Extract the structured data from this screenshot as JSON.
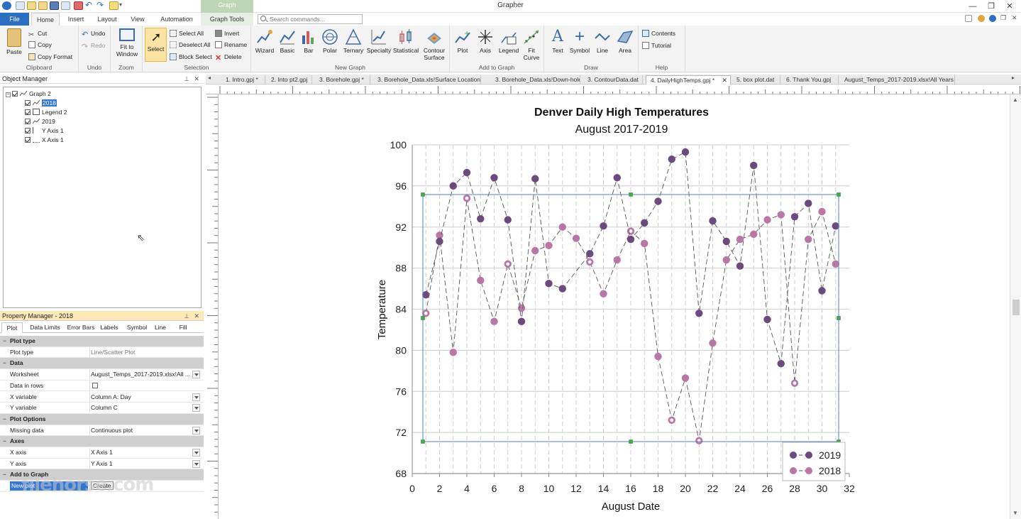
{
  "app": {
    "title": "Grapher",
    "context_group": "Graph"
  },
  "ribbon_tabs": [
    "File",
    "Home",
    "Insert",
    "Layout",
    "View",
    "Automation",
    "Graph Tools"
  ],
  "search": {
    "placeholder": "Search commands..."
  },
  "ribbon": {
    "clipboard": {
      "label": "Clipboard",
      "paste": "Paste",
      "cut": "Cut",
      "copy": "Copy",
      "copy_format": "Copy Format"
    },
    "undo": {
      "label": "Undo",
      "undo": "Undo",
      "redo": "Redo"
    },
    "zoom": {
      "label": "Zoom",
      "fit": "Fit to Window"
    },
    "selection": {
      "label": "Selection",
      "select": "Select",
      "select_all": "Select All",
      "deselect_all": "Deselect All",
      "block_select": "Block Select",
      "invert": "Invert",
      "rename": "Rename",
      "delete": "Delete"
    },
    "new_graph": {
      "label": "New Graph",
      "items": [
        "Wizard",
        "Basic",
        "Bar",
        "Polar",
        "Ternary",
        "Specialty",
        "Statistical",
        "Contour Surface"
      ]
    },
    "add_to_graph": {
      "label": "Add to Graph",
      "items": [
        "Plot",
        "Axis",
        "Legend",
        "Fit Curve"
      ]
    },
    "draw": {
      "label": "Draw",
      "items": [
        "Text",
        "Symbol",
        "Line",
        "Area"
      ]
    },
    "help": {
      "label": "Help",
      "contents": "Contents",
      "tutorial": "Tutorial"
    }
  },
  "object_manager": {
    "title": "Object Manager",
    "items": [
      {
        "label": "Graph 2",
        "level": 0
      },
      {
        "label": "2018",
        "level": 1,
        "selected": true
      },
      {
        "label": "Legend 2",
        "level": 1
      },
      {
        "label": "2019",
        "level": 1
      },
      {
        "label": "Y Axis 1",
        "level": 1
      },
      {
        "label": "X Axis 1",
        "level": 1
      }
    ]
  },
  "property_manager": {
    "title": "Property Manager - 2018",
    "tabs": [
      "Plot",
      "Data Limits",
      "Error Bars",
      "Labels",
      "Symbol",
      "Line",
      "Fill"
    ],
    "rows": [
      {
        "section": "Plot type"
      },
      {
        "k": "Plot type",
        "v": "Line/Scatter Plot"
      },
      {
        "section": "Data"
      },
      {
        "k": "Worksheet",
        "v": "August_Temps_2017-2019.xlsx!All ..."
      },
      {
        "k": "Data in rows",
        "v": ""
      },
      {
        "k": "X variable",
        "v": "Column A: Day"
      },
      {
        "k": "Y variable",
        "v": "Column C"
      },
      {
        "section": "Plot Options"
      },
      {
        "k": "Missing data",
        "v": "Continuous plot"
      },
      {
        "section": "Axes"
      },
      {
        "k": "X axis",
        "v": "X Axis 1"
      },
      {
        "k": "Y axis",
        "v": "Y Axis 1"
      },
      {
        "section": "Add to Graph"
      },
      {
        "k": "New plot",
        "v": "Create"
      }
    ]
  },
  "doc_tabs": [
    "1. Intro.gpj *",
    "2. Into pt2.gpj",
    "3. Borehole.gpj *",
    "3. Borehole_Data.xls!Surface Location",
    "3. Borehole_Data.xls!Down-hole",
    "3. ContourData.dat",
    "4. DailyHighTemps.gpj *",
    "5. box plot.dat",
    "6. Thank You.gpj",
    "August_Temps_2017-2019.xlsx!All Years"
  ],
  "watermark": "filehorse.com",
  "chart_data": {
    "type": "line",
    "title": "Denver Daily High Temperatures",
    "subtitle": "August 2017-2019",
    "xlabel": "August Date",
    "ylabel": "Temperature",
    "xlim": [
      0,
      32
    ],
    "ylim": [
      68,
      100
    ],
    "xticks": [
      0,
      2,
      4,
      6,
      8,
      10,
      12,
      14,
      16,
      18,
      20,
      22,
      24,
      26,
      28,
      30,
      32
    ],
    "yticks": [
      68,
      72,
      76,
      80,
      84,
      88,
      92,
      96,
      100
    ],
    "grid": true,
    "legend": "bottom-right",
    "x": [
      1,
      2,
      3,
      4,
      5,
      6,
      7,
      8,
      9,
      10,
      11,
      12,
      13,
      14,
      15,
      16,
      17,
      18,
      19,
      20,
      21,
      22,
      23,
      24,
      25,
      26,
      27,
      28,
      29,
      30,
      31
    ],
    "series": [
      {
        "name": "2019",
        "color": "#6b4a7d",
        "values": [
          85.4,
          90.6,
          96.0,
          97.3,
          92.8,
          96.8,
          92.7,
          82.8,
          96.7,
          86.5,
          86.0,
          null,
          89.4,
          92.1,
          96.8,
          90.8,
          92.4,
          94.5,
          98.6,
          99.3,
          83.6,
          92.6,
          90.6,
          88.2,
          98.0,
          83.0,
          78.7,
          93.0,
          94.3,
          85.8,
          92.1
        ]
      },
      {
        "name": "2018",
        "color": "#b877a4",
        "values": [
          83.6,
          91.2,
          79.8,
          94.8,
          86.8,
          82.8,
          88.4,
          84.1,
          89.7,
          90.2,
          92.0,
          90.9,
          88.6,
          85.5,
          88.8,
          91.6,
          90.4,
          79.4,
          73.2,
          77.3,
          71.2,
          80.7,
          88.8,
          90.8,
          91.3,
          92.7,
          93.2,
          76.8,
          90.8,
          93.5,
          88.4
        ]
      }
    ]
  }
}
